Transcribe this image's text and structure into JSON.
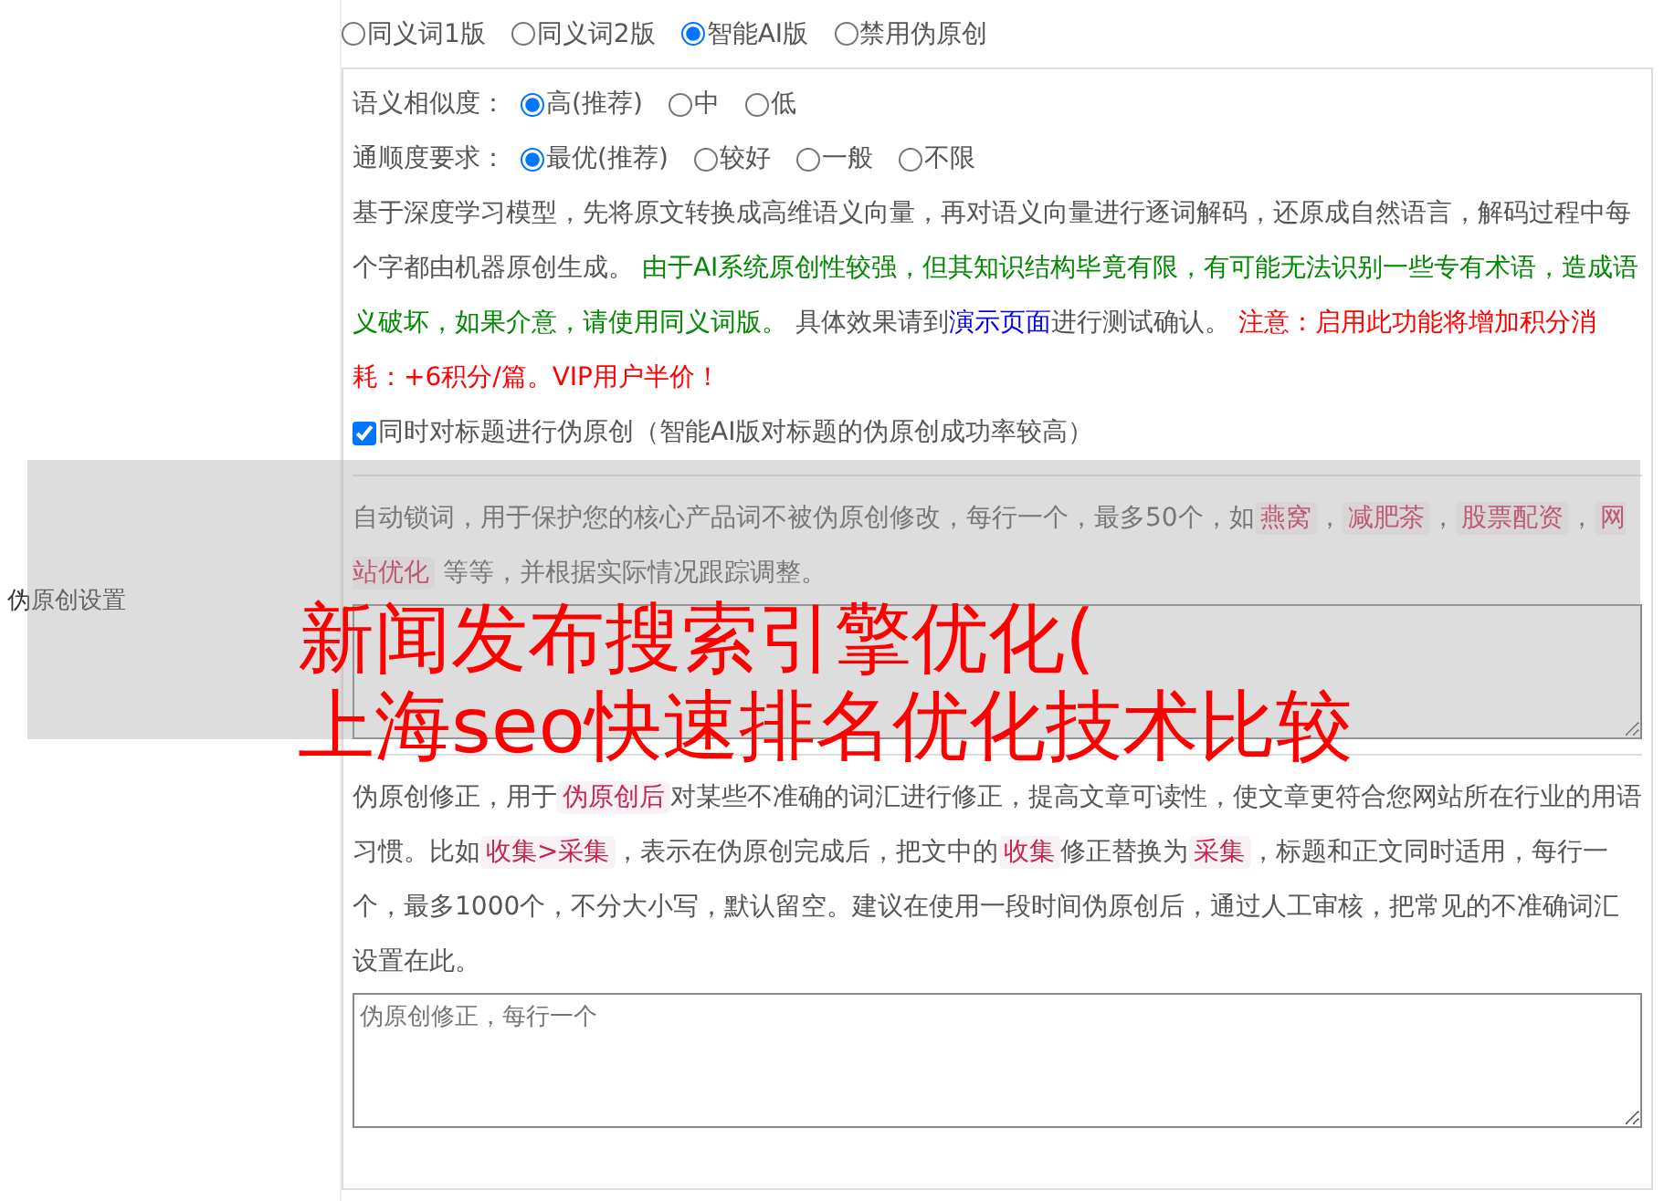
{
  "settings_label": "伪原创设置",
  "mode_options": [
    {
      "label": "同义词1版",
      "selected": false
    },
    {
      "label": "同义词2版",
      "selected": false
    },
    {
      "label": "智能AI版",
      "selected": true
    },
    {
      "label": "禁用伪原创",
      "selected": false
    }
  ],
  "similarity": {
    "label": "语义相似度：",
    "options": [
      {
        "label": "高(推荐)",
        "selected": true
      },
      {
        "label": "中",
        "selected": false
      },
      {
        "label": "低",
        "selected": false
      }
    ]
  },
  "fluency": {
    "label": "通顺度要求：",
    "options": [
      {
        "label": "最优(推荐)",
        "selected": true
      },
      {
        "label": "较好",
        "selected": false
      },
      {
        "label": "一般",
        "selected": false
      },
      {
        "label": "不限",
        "selected": false
      }
    ]
  },
  "description": [
    {
      "kind": "text",
      "text": "基于深度学习模型，先将原文转换成高维语义向量，再对语义向量进行逐词解码，还原成自然语言，解码过程中每个字都由机器原创生成。 "
    },
    {
      "kind": "green",
      "text": "由于AI系统原创性较强，但其知识结构毕竟有限，有可能无法识别一些专有术语，造成语义破坏，如果介意，请使用同义词版。"
    },
    {
      "kind": "text",
      "text": " 具体效果请到"
    },
    {
      "kind": "link",
      "text": "演示页面"
    },
    {
      "kind": "text",
      "text": "进行测试确认。 "
    },
    {
      "kind": "red",
      "text": "注意：启用此功能将增加积分消耗：+6积分/篇。VIP用户半价！"
    }
  ],
  "title_option": {
    "label": "同时对标题进行伪原创（智能AI版对标题的伪原创成功率较高）",
    "checked": true
  },
  "lock_words": {
    "description": [
      {
        "kind": "text",
        "text": "自动锁词，用于保护您的核心产品词不被伪原创修改，每行一个，最多50个，如"
      },
      {
        "kind": "code",
        "text": "燕窝"
      },
      {
        "kind": "text",
        "text": "，"
      },
      {
        "kind": "code",
        "text": "减肥茶"
      },
      {
        "kind": "text",
        "text": "，"
      },
      {
        "kind": "code",
        "text": "股票配资"
      },
      {
        "kind": "text",
        "text": "，"
      },
      {
        "kind": "code",
        "text": "网站优化"
      },
      {
        "kind": "text",
        "text": " 等等，并根据实际情况跟踪调整。"
      }
    ]
  },
  "corrections": {
    "description": [
      {
        "kind": "text",
        "text": "伪原创修正，用于"
      },
      {
        "kind": "code",
        "text": "伪原创后"
      },
      {
        "kind": "text",
        "text": "对某些不准确的词汇进行修正，提高文章可读性，使文章更符合您网站所在行业的用语习惯。比如"
      },
      {
        "kind": "code",
        "text": "收集>采集"
      },
      {
        "kind": "text",
        "text": "，表示在伪原创完成后，把文中的"
      },
      {
        "kind": "code",
        "text": "收集"
      },
      {
        "kind": "text",
        "text": "修正替换为"
      },
      {
        "kind": "code",
        "text": "采集"
      },
      {
        "kind": "text",
        "text": "，标题和正文同时适用，每行一个，最多1000个，不分大小写，默认留空。建议在使用一段时间伪原创后，通过人工审核，把常见的不准确词汇设置在此。"
      }
    ],
    "placeholder": "伪原创修正，每行一个"
  },
  "overlay": {
    "title_lines": [
      "新闻发布搜索引擎优化(",
      "上海seo快速排名优化技术比较"
    ]
  }
}
